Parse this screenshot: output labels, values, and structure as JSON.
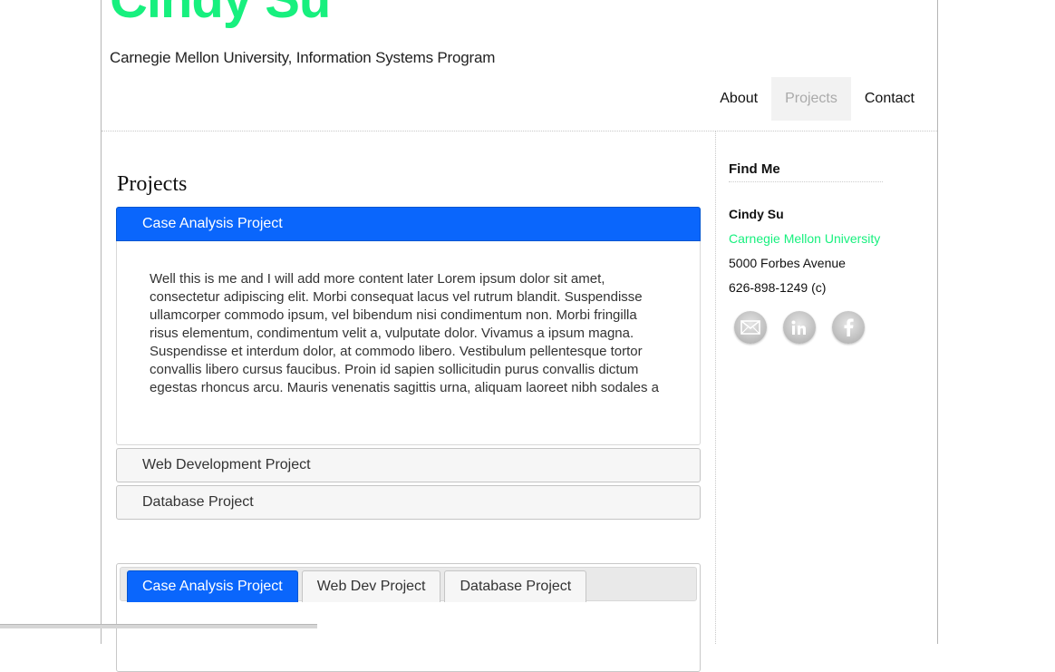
{
  "header": {
    "site_title": "Cindy Su",
    "tagline": "Carnegie Mellon University, Information Systems Program"
  },
  "nav": {
    "items": [
      {
        "label": "About",
        "active": false
      },
      {
        "label": "Projects",
        "active": true
      },
      {
        "label": "Contact",
        "active": false
      }
    ]
  },
  "main": {
    "title": "Projects",
    "accordion": [
      {
        "label": "Case Analysis Project",
        "expanded": true
      },
      {
        "label": "Web Development Project",
        "expanded": false
      },
      {
        "label": "Database Project",
        "expanded": false
      }
    ],
    "panel_text": "Well this is me and I will add more content later Lorem ipsum dolor sit amet, consectetur adipiscing elit. Morbi consequat lacus vel rutrum blandit. Suspendisse ullamcorper commodo ipsum, vel bibendum nisi condimentum non. Morbi fringilla risus elementum, condimentum velit a, vulputate dolor. Vivamus a ipsum magna. Suspendisse et interdum dolor, at commodo libero. Vestibulum pellentesque tortor convallis libero cursus faucibus. Proin id sapien sollicitudin purus convallis dictum egestas rhoncus arcu. Mauris venenatis sagittis urna, aliquam laoreet nibh sodales a",
    "tabs": [
      {
        "label": "Case Analysis Project",
        "active": true
      },
      {
        "label": "Web Dev Project",
        "active": false
      },
      {
        "label": "Database Project",
        "active": false
      }
    ]
  },
  "sidebar": {
    "title": "Find Me",
    "name": "Cindy Su",
    "school": "Carnegie Mellon University",
    "address": "5000 Forbes Avenue",
    "phone": "626-898-1249 (c)",
    "social": [
      {
        "icon": "email-icon"
      },
      {
        "icon": "linkedin-icon"
      },
      {
        "icon": "facebook-icon"
      }
    ]
  },
  "colors": {
    "accent_green": "#17f07e",
    "active_blue": "#0a66fc"
  }
}
